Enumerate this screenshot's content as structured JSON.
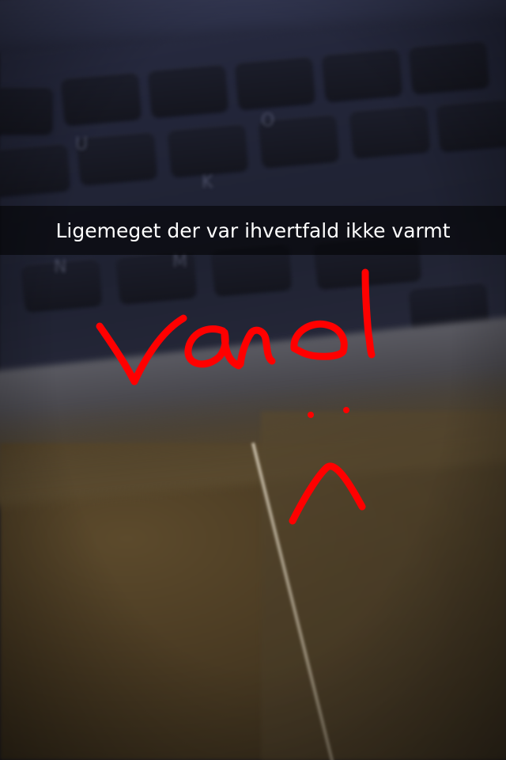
{
  "caption": {
    "text": "Ligemeget der var ihvertfald ikke varmt"
  },
  "drawing": {
    "word": "vand",
    "color": "#ff0000",
    "face": "sad-face"
  },
  "background": {
    "scene": "laptop-keyboard-and-trackpad",
    "key_glyphs": [
      "U",
      "O",
      "K",
      "N",
      "M"
    ]
  }
}
